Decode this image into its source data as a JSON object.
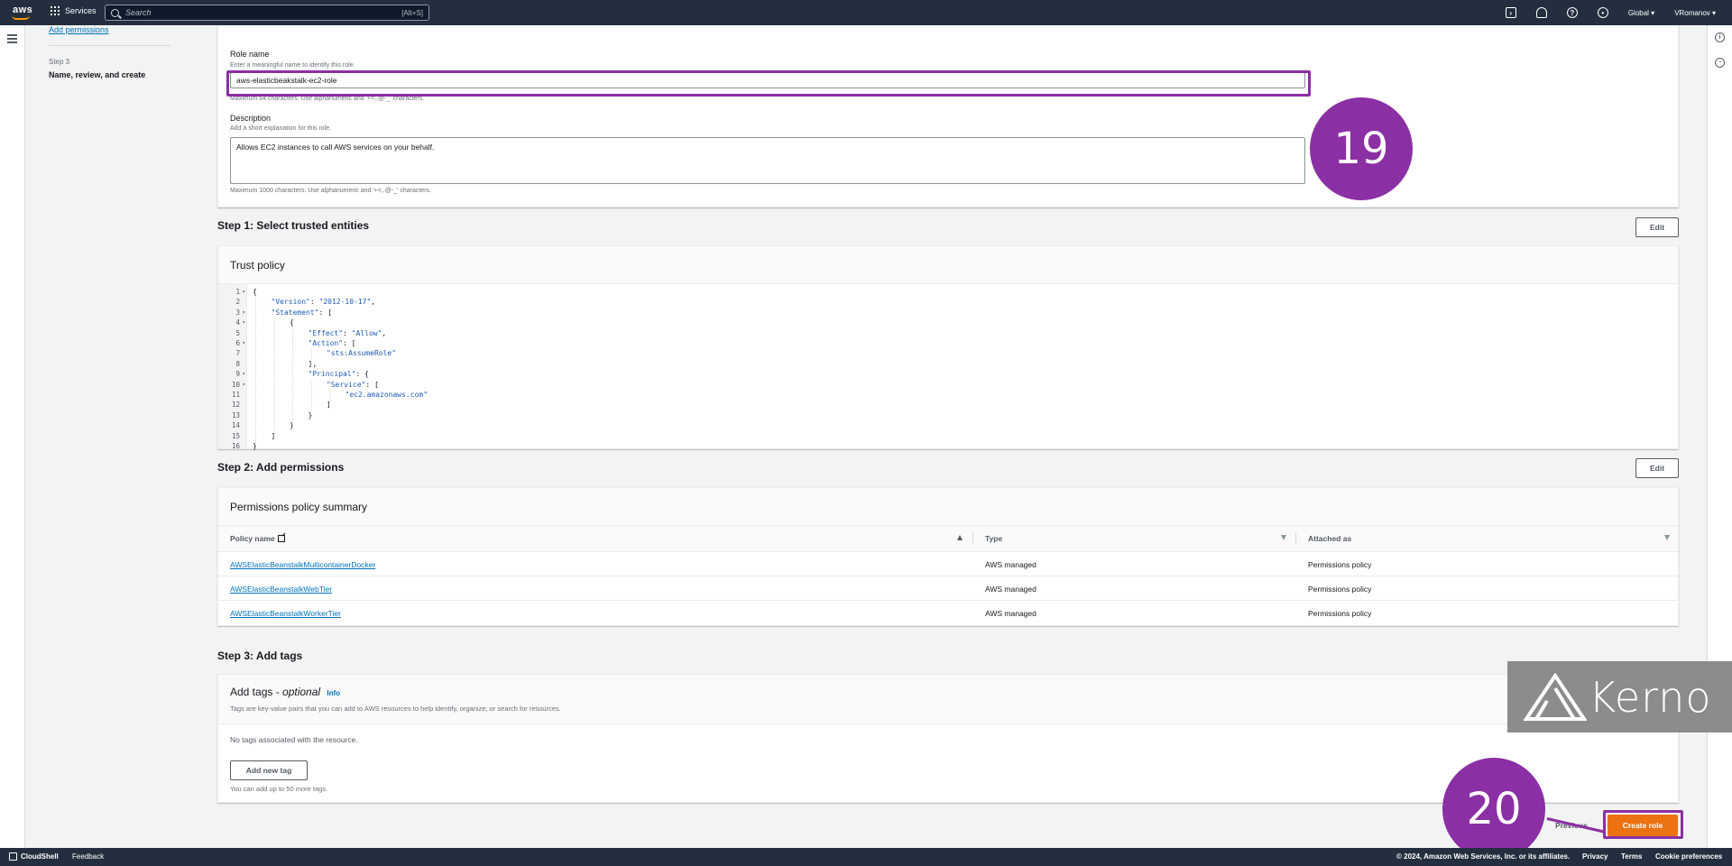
{
  "topnav": {
    "logo": "aws",
    "services": "Services",
    "search_placeholder": "Search",
    "search_shortcut": "[Alt+S]",
    "region": "Global ▾",
    "user": "VRomanov ▾",
    "icons": [
      "cloudshell-icon",
      "bell-icon",
      "help-icon",
      "settings-icon"
    ]
  },
  "steps_nav": {
    "add_permissions_link": "Add permissions",
    "step3_label": "Step 3",
    "step3_title": "Name, review, and create"
  },
  "role_details": {
    "role_name_label": "Role name",
    "role_name_hint": "Enter a meaningful name to identify this role.",
    "role_name_value": "aws-elasticbeakstalk-ec2-role",
    "role_name_constraint": "Maximum 64 characters. Use alphanumeric and '+=,.@-_' characters.",
    "description_label": "Description",
    "description_hint": "Add a short explanation for this role.",
    "description_value": "Allows EC2 instances to call AWS services on your behalf.",
    "description_constraint": "Maximum 1000 characters. Use alphanumeric and '+=,.@-_' characters."
  },
  "step1": {
    "title": "Step 1: Select trusted entities",
    "edit": "Edit",
    "card_title": "Trust policy",
    "code_lines": [
      {
        "n": "1",
        "fold": true,
        "indent": 0,
        "text": "{"
      },
      {
        "n": "2",
        "fold": false,
        "indent": 1,
        "text": "\"Version\": \"2012-10-17\","
      },
      {
        "n": "3",
        "fold": true,
        "indent": 1,
        "text": "\"Statement\": ["
      },
      {
        "n": "4",
        "fold": true,
        "indent": 2,
        "text": "{"
      },
      {
        "n": "5",
        "fold": false,
        "indent": 3,
        "text": "\"Effect\": \"Allow\","
      },
      {
        "n": "6",
        "fold": true,
        "indent": 3,
        "text": "\"Action\": ["
      },
      {
        "n": "7",
        "fold": false,
        "indent": 4,
        "text": "\"sts:AssumeRole\""
      },
      {
        "n": "8",
        "fold": false,
        "indent": 3,
        "text": "],"
      },
      {
        "n": "9",
        "fold": true,
        "indent": 3,
        "text": "\"Principal\": {"
      },
      {
        "n": "10",
        "fold": true,
        "indent": 4,
        "text": "\"Service\": ["
      },
      {
        "n": "11",
        "fold": false,
        "indent": 5,
        "text": "\"ec2.amazonaws.com\""
      },
      {
        "n": "12",
        "fold": false,
        "indent": 4,
        "text": "]"
      },
      {
        "n": "13",
        "fold": false,
        "indent": 3,
        "text": "}"
      },
      {
        "n": "14",
        "fold": false,
        "indent": 2,
        "text": "}"
      },
      {
        "n": "15",
        "fold": false,
        "indent": 1,
        "text": "]"
      },
      {
        "n": "16",
        "fold": false,
        "indent": 0,
        "text": "}"
      }
    ]
  },
  "step2": {
    "title": "Step 2: Add permissions",
    "edit": "Edit",
    "card_title": "Permissions policy summary",
    "columns": [
      "Policy name",
      "Type",
      "Attached as"
    ],
    "rows": [
      {
        "name": "AWSElasticBeanstalkMulticontainerDocker",
        "type": "AWS managed",
        "attached": "Permissions policy"
      },
      {
        "name": "AWSElasticBeanstalkWebTier",
        "type": "AWS managed",
        "attached": "Permissions policy"
      },
      {
        "name": "AWSElasticBeanstalkWorkerTier",
        "type": "AWS managed",
        "attached": "Permissions policy"
      }
    ]
  },
  "step3": {
    "title": "Step 3: Add tags",
    "card_title": "Add tags - ",
    "card_title_optional": "optional",
    "info": "Info",
    "description": "Tags are key-value pairs that you can add to AWS resources to help identify, organize, or search for resources.",
    "empty": "No tags associated with the resource.",
    "add_button": "Add new tag",
    "limit": "You can add up to 50 more tags."
  },
  "actions": {
    "previous": "Previous",
    "create": "Create role"
  },
  "annotations": {
    "badge1": "19",
    "badge2": "20",
    "watermark": "Kerno",
    "color": "#8b2fa4"
  },
  "footer": {
    "cloudshell": "CloudShell",
    "feedback": "Feedback",
    "copyright": "© 2024, Amazon Web Services, Inc. or its affiliates.",
    "privacy": "Privacy",
    "terms": "Terms",
    "cookies": "Cookie preferences"
  }
}
